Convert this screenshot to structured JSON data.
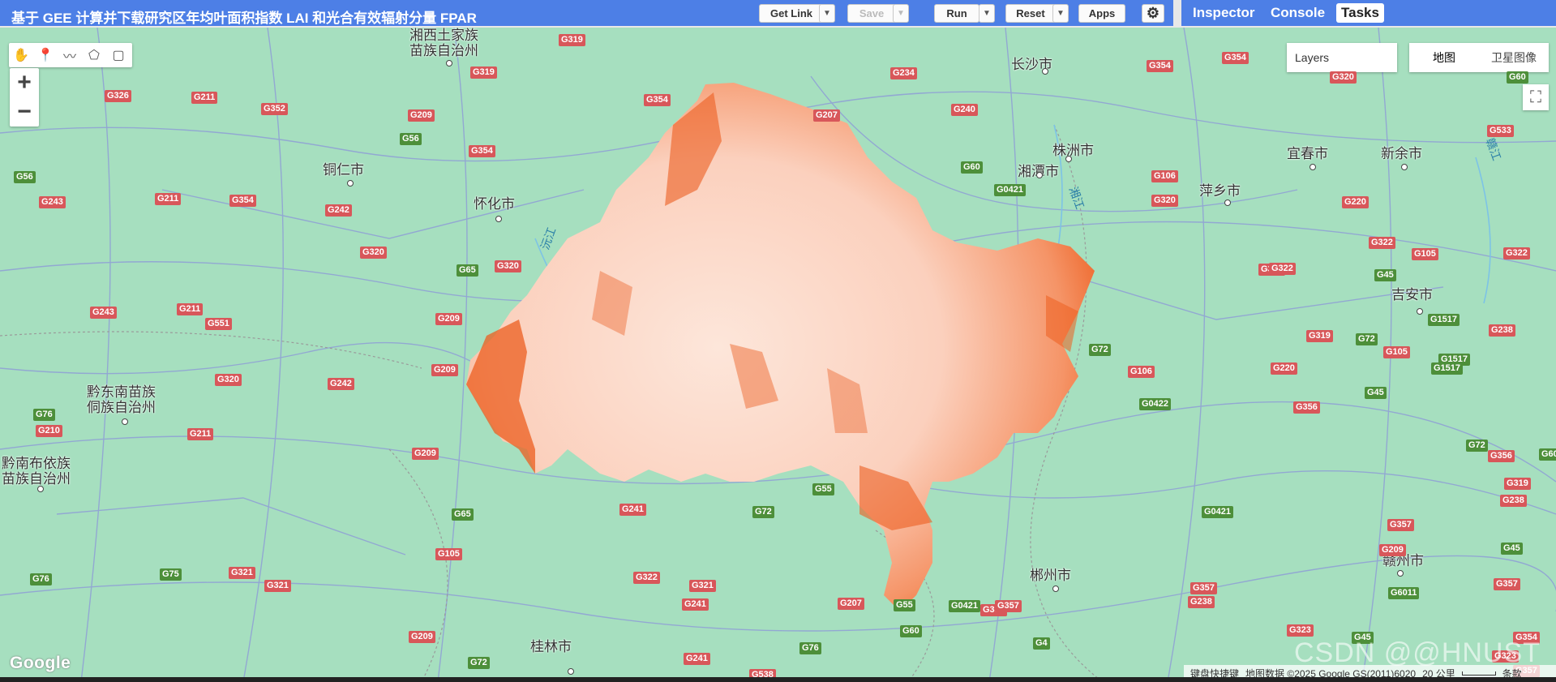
{
  "header": {
    "title": "基于 GEE 计算并下载研究区年均叶面积指数 LAI 和光合有效辐射分量 FPAR",
    "get_link": "Get Link",
    "save": "Save",
    "run": "Run",
    "reset": "Reset",
    "apps": "Apps",
    "settings_icon": "gear-icon"
  },
  "panel_tabs": [
    "Inspector",
    "Console",
    "Tasks"
  ],
  "active_tab": "Tasks",
  "map": {
    "layers_label": "Layers",
    "map_types": [
      "地图",
      "卫星图像"
    ],
    "active_map_type": "地图",
    "drawing_tools": [
      "hand-icon",
      "marker-icon",
      "polyline-icon",
      "polygon-icon",
      "rectangle-icon"
    ],
    "zoom_in": "+",
    "zoom_out": "−",
    "cities": [
      {
        "id": "changsha",
        "name": "长沙市"
      },
      {
        "id": "zhuzhou",
        "name": "株洲市"
      },
      {
        "id": "xiangtan",
        "name": "湘潭市"
      },
      {
        "id": "tongren",
        "name": "铜仁市"
      },
      {
        "id": "huaihua",
        "name": "怀化市"
      },
      {
        "id": "yichun",
        "name": "宜春市"
      },
      {
        "id": "xinyu",
        "name": "新余市"
      },
      {
        "id": "pingxiang",
        "name": "萍乡市"
      },
      {
        "id": "jian",
        "name": "吉安市"
      },
      {
        "id": "qiandongnan",
        "name": "黔东南苗族\n侗族自治州"
      },
      {
        "id": "qiannan",
        "name": "黔南布依族\n苗族自治州"
      },
      {
        "id": "chenzhou",
        "name": "郴州市"
      },
      {
        "id": "ganzhou",
        "name": "赣州市"
      },
      {
        "id": "xiangxi",
        "name": "湘西土家族\n苗族自治州"
      },
      {
        "id": "guilin",
        "name": "桂林市"
      }
    ],
    "rivers": [
      "沅江",
      "湘江",
      "赣江"
    ],
    "road_shields": [
      {
        "label": "G319",
        "c": "r"
      },
      {
        "label": "G319",
        "c": "r"
      },
      {
        "label": "G234",
        "c": "r"
      },
      {
        "label": "G354",
        "c": "r"
      },
      {
        "label": "G354",
        "c": "r"
      },
      {
        "label": "G326",
        "c": "r"
      },
      {
        "label": "G211",
        "c": "r"
      },
      {
        "label": "G352",
        "c": "r"
      },
      {
        "label": "G209",
        "c": "r"
      },
      {
        "label": "G354",
        "c": "r"
      },
      {
        "label": "G207",
        "c": "r"
      },
      {
        "label": "G240",
        "c": "r"
      },
      {
        "label": "G320",
        "c": "r"
      },
      {
        "label": "G60",
        "c": "g"
      },
      {
        "label": "G56",
        "c": "g"
      },
      {
        "label": "G354",
        "c": "r"
      },
      {
        "label": "G533",
        "c": "r"
      },
      {
        "label": "G56",
        "c": "g"
      },
      {
        "label": "G243",
        "c": "r"
      },
      {
        "label": "G211",
        "c": "r"
      },
      {
        "label": "G354",
        "c": "r"
      },
      {
        "label": "G242",
        "c": "r"
      },
      {
        "label": "G60",
        "c": "g"
      },
      {
        "label": "G0421",
        "c": "g"
      },
      {
        "label": "G106",
        "c": "r"
      },
      {
        "label": "G320",
        "c": "r"
      },
      {
        "label": "G220",
        "c": "r"
      },
      {
        "label": "G320",
        "c": "r"
      },
      {
        "label": "G65",
        "c": "g"
      },
      {
        "label": "G320",
        "c": "r"
      },
      {
        "label": "G322",
        "c": "r"
      },
      {
        "label": "G105",
        "c": "r"
      },
      {
        "label": "G322",
        "c": "r"
      },
      {
        "label": "G319",
        "c": "r"
      },
      {
        "label": "G322",
        "c": "r"
      },
      {
        "label": "G45",
        "c": "g"
      },
      {
        "label": "G243",
        "c": "r"
      },
      {
        "label": "G211",
        "c": "r"
      },
      {
        "label": "G551",
        "c": "r"
      },
      {
        "label": "G209",
        "c": "r"
      },
      {
        "label": "G1517",
        "c": "g"
      },
      {
        "label": "G238",
        "c": "r"
      },
      {
        "label": "G319",
        "c": "r"
      },
      {
        "label": "G72",
        "c": "g"
      },
      {
        "label": "G105",
        "c": "r"
      },
      {
        "label": "G1517",
        "c": "g"
      },
      {
        "label": "G320",
        "c": "r"
      },
      {
        "label": "G242",
        "c": "r"
      },
      {
        "label": "G209",
        "c": "r"
      },
      {
        "label": "G220",
        "c": "r"
      },
      {
        "label": "G1517",
        "c": "g"
      },
      {
        "label": "G106",
        "c": "r"
      },
      {
        "label": "G72",
        "c": "g"
      },
      {
        "label": "G76",
        "c": "g"
      },
      {
        "label": "G0422",
        "c": "g"
      },
      {
        "label": "G356",
        "c": "r"
      },
      {
        "label": "G45",
        "c": "g"
      },
      {
        "label": "G210",
        "c": "r"
      },
      {
        "label": "G211",
        "c": "r"
      },
      {
        "label": "G72",
        "c": "g"
      },
      {
        "label": "G209",
        "c": "r"
      },
      {
        "label": "G356",
        "c": "r"
      },
      {
        "label": "G60",
        "c": "g"
      },
      {
        "label": "G319",
        "c": "r"
      },
      {
        "label": "G65",
        "c": "g"
      },
      {
        "label": "G241",
        "c": "r"
      },
      {
        "label": "G72",
        "c": "g"
      },
      {
        "label": "G55",
        "c": "g"
      },
      {
        "label": "G238",
        "c": "r"
      },
      {
        "label": "G0421",
        "c": "g"
      },
      {
        "label": "G357",
        "c": "r"
      },
      {
        "label": "G105",
        "c": "r"
      },
      {
        "label": "G209",
        "c": "r"
      },
      {
        "label": "G45",
        "c": "g"
      },
      {
        "label": "G76",
        "c": "g"
      },
      {
        "label": "G75",
        "c": "g"
      },
      {
        "label": "G321",
        "c": "r"
      },
      {
        "label": "G321",
        "c": "r"
      },
      {
        "label": "G322",
        "c": "r"
      },
      {
        "label": "G321",
        "c": "r"
      },
      {
        "label": "G241",
        "c": "r"
      },
      {
        "label": "G207",
        "c": "r"
      },
      {
        "label": "G55",
        "c": "g"
      },
      {
        "label": "G0421",
        "c": "g"
      },
      {
        "label": "G357",
        "c": "r"
      },
      {
        "label": "G357",
        "c": "r"
      },
      {
        "label": "G357",
        "c": "r"
      },
      {
        "label": "G6011",
        "c": "g"
      },
      {
        "label": "G238",
        "c": "r"
      },
      {
        "label": "G357",
        "c": "r"
      },
      {
        "label": "G323",
        "c": "r"
      },
      {
        "label": "G45",
        "c": "g"
      },
      {
        "label": "G209",
        "c": "r"
      },
      {
        "label": "G72",
        "c": "g"
      },
      {
        "label": "G241",
        "c": "r"
      },
      {
        "label": "G76",
        "c": "g"
      },
      {
        "label": "G4",
        "c": "g"
      },
      {
        "label": "G538",
        "c": "r"
      },
      {
        "label": "G357",
        "c": "r"
      },
      {
        "label": "G60",
        "c": "g"
      },
      {
        "label": "G354",
        "c": "r"
      },
      {
        "label": "G323",
        "c": "r"
      }
    ],
    "attribution": {
      "shortcuts": "键盘快捷键",
      "data": "地图数据 ©2025 Google GS(2011)6020",
      "scale": "20 公里",
      "terms": "条款"
    },
    "logo": "Google",
    "watermark": "CSDN @@HNUST"
  },
  "colors": {
    "header_blue": "#4d7fe6",
    "map_green": "#a6dfbf",
    "lai_low": "#fde3d6",
    "lai_high": "#ec5e1f"
  }
}
